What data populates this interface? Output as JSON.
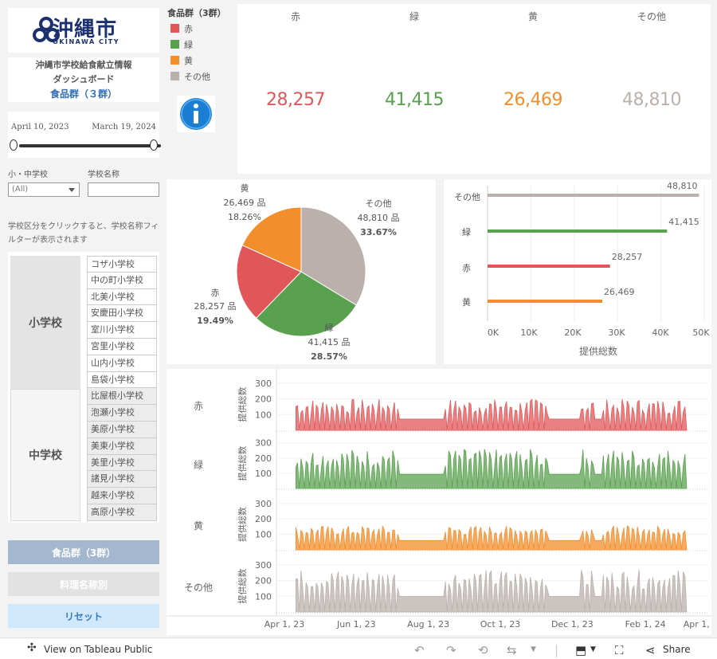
{
  "logo": {
    "name": "沖縄市",
    "sub": "OKINAWA CITY"
  },
  "title": {
    "line1": "沖縄市学校給食献立情報",
    "line2": "ダッシュボード",
    "line3": "食品群（３群）"
  },
  "date_range": {
    "start": "April 10, 2023",
    "end": "March 19, 2024",
    "start_fraction": 0.0,
    "end_fraction": 1.0
  },
  "filters": {
    "school_type_label": "小・中学校",
    "school_type_value": "(All)",
    "school_name_label": "学校名称",
    "school_name_value": ""
  },
  "note": "学校区分をクリックすると、学校名称フィルターが表示されます",
  "school_types": [
    "小学校",
    "中学校"
  ],
  "schools": [
    "コザ小学校",
    "中の町小学校",
    "北美小学校",
    "安慶田小学校",
    "室川小学校",
    "宮里小学校",
    "山内小学校",
    "島袋小学校",
    "比屋根小学校",
    "泡瀬小学校",
    "美原小学校",
    "美東小学校",
    "美里小学校",
    "諸見小学校",
    "越来小学校",
    "高原小学校"
  ],
  "buttons": {
    "group": "食品群（3群）",
    "dish": "料理名称別",
    "reset": "リセット"
  },
  "legend": {
    "title": "食品群（3群）",
    "items": [
      {
        "label": "赤",
        "color": "#e15759"
      },
      {
        "label": "緑",
        "color": "#59a14f"
      },
      {
        "label": "黄",
        "color": "#f28e2b"
      },
      {
        "label": "その他",
        "color": "#bab0ac"
      }
    ]
  },
  "info_icon": "info-icon",
  "kpi": [
    {
      "label": "赤",
      "value": "28,257",
      "color": "#e15759"
    },
    {
      "label": "緑",
      "value": "41,415",
      "color": "#59a14f"
    },
    {
      "label": "黄",
      "value": "26,469",
      "color": "#f28e2b"
    },
    {
      "label": "その他",
      "value": "48,810",
      "color": "#bab0ac"
    }
  ],
  "chart_data": [
    {
      "type": "pie",
      "slices": [
        {
          "label": "その他",
          "value": 48810,
          "value_label": "48,810 品",
          "percent": "33.67%",
          "color": "#bab0ac"
        },
        {
          "label": "緑",
          "value": 41415,
          "value_label": "41,415 品",
          "percent": "28.57%",
          "color": "#59a14f"
        },
        {
          "label": "赤",
          "value": 28257,
          "value_label": "28,257 品",
          "percent": "19.49%",
          "color": "#e15759"
        },
        {
          "label": "黄",
          "value": 26469,
          "value_label": "26,469 品",
          "percent": "18.26%",
          "color": "#f28e2b"
        }
      ]
    },
    {
      "type": "bar",
      "orientation": "horizontal",
      "categories": [
        "その他",
        "緑",
        "赤",
        "黄"
      ],
      "values": [
        48810,
        41415,
        28257,
        26469
      ],
      "value_labels": [
        "48,810",
        "41,415",
        "28,257",
        "26,469"
      ],
      "colors": [
        "#bab0ac",
        "#59a14f",
        "#e15759",
        "#f28e2b"
      ],
      "xlabel": "提供総数",
      "xlim": [
        0,
        50000
      ],
      "xticks": [
        "0K",
        "10K",
        "20K",
        "30K",
        "40K",
        "50K"
      ]
    },
    {
      "type": "area",
      "ylabel": "提供総数",
      "yticks": [
        "300",
        "200",
        "100"
      ],
      "ylim": [
        0,
        330
      ],
      "x_ticks": [
        "Apr 1, 23",
        "Jun 1, 23",
        "Aug 1, 23",
        "Oct 1, 23",
        "Dec 1, 23",
        "Feb 1, 24",
        "Apr 1, 24"
      ],
      "x_range": [
        "2023-04-01",
        "2024-04-01"
      ],
      "series": [
        {
          "name": "赤",
          "color": "#e15759",
          "base": 130,
          "amp": 70
        },
        {
          "name": "緑",
          "color": "#59a14f",
          "base": 170,
          "amp": 90
        },
        {
          "name": "黄",
          "color": "#f28e2b",
          "base": 110,
          "amp": 45
        },
        {
          "name": "その他",
          "color": "#bab0ac",
          "base": 180,
          "amp": 90
        }
      ]
    }
  ],
  "footer": {
    "view_label": "View on Tableau Public",
    "share_label": "Share"
  }
}
